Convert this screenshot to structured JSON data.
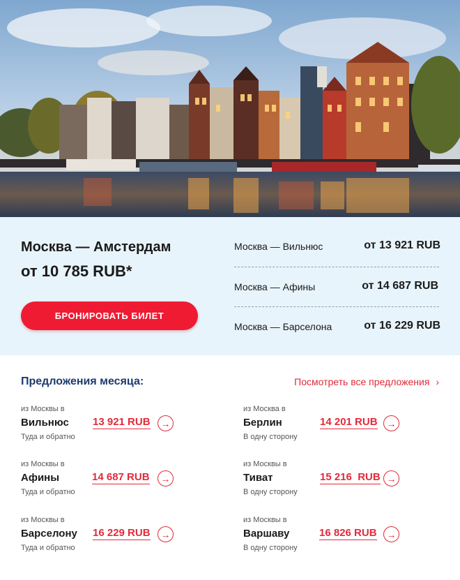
{
  "hero": {
    "image": "amsterdam-canal-houses"
  },
  "promo": {
    "main_route": "Москва — Амстердам",
    "main_price": "от 10 785 RUB*",
    "book_button": "БРОНИРОВАТЬ БИЛЕТ",
    "routes": [
      {
        "route": "Москва — Вильнюс",
        "price": "от 13 921 RUB"
      },
      {
        "route": "Москва — Афины",
        "price": "от 14 687 RUB"
      },
      {
        "route": "Москва — Барселона",
        "price": "от 16 229 RUB"
      }
    ]
  },
  "offers": {
    "title": "Предложения месяца:",
    "all_link": "Посмотреть все предложения",
    "link_chevron": "›",
    "arrow_icon": "→",
    "left": [
      {
        "from": "из Москвы в",
        "city": "Вильнюс",
        "price": "13 921 RUB",
        "trip": "Туда и обратно"
      },
      {
        "from": "из Москвы в",
        "city": "Афины",
        "price": "14 687 RUB",
        "trip": "Туда и обратно"
      },
      {
        "from": "из Москвы в",
        "city": "Барселону",
        "price": "16 229 RUB",
        "trip": "Туда и обратно"
      }
    ],
    "right": [
      {
        "from": "из Москва в",
        "city": "Берлин",
        "price": "14 201 RUB",
        "trip": "В одну сторону"
      },
      {
        "from": "из Москвы в",
        "city": "Тиват",
        "price": "15 216  RUB",
        "trip": "В одну сторону"
      },
      {
        "from": "из Москвы в",
        "city": "Варшаву",
        "price": "16 826 RUB",
        "trip": "В одну сторону"
      }
    ]
  },
  "colors": {
    "accent": "#ee1b33",
    "promo_bg": "#e8f4fb",
    "title_blue": "#1e3a6d"
  }
}
